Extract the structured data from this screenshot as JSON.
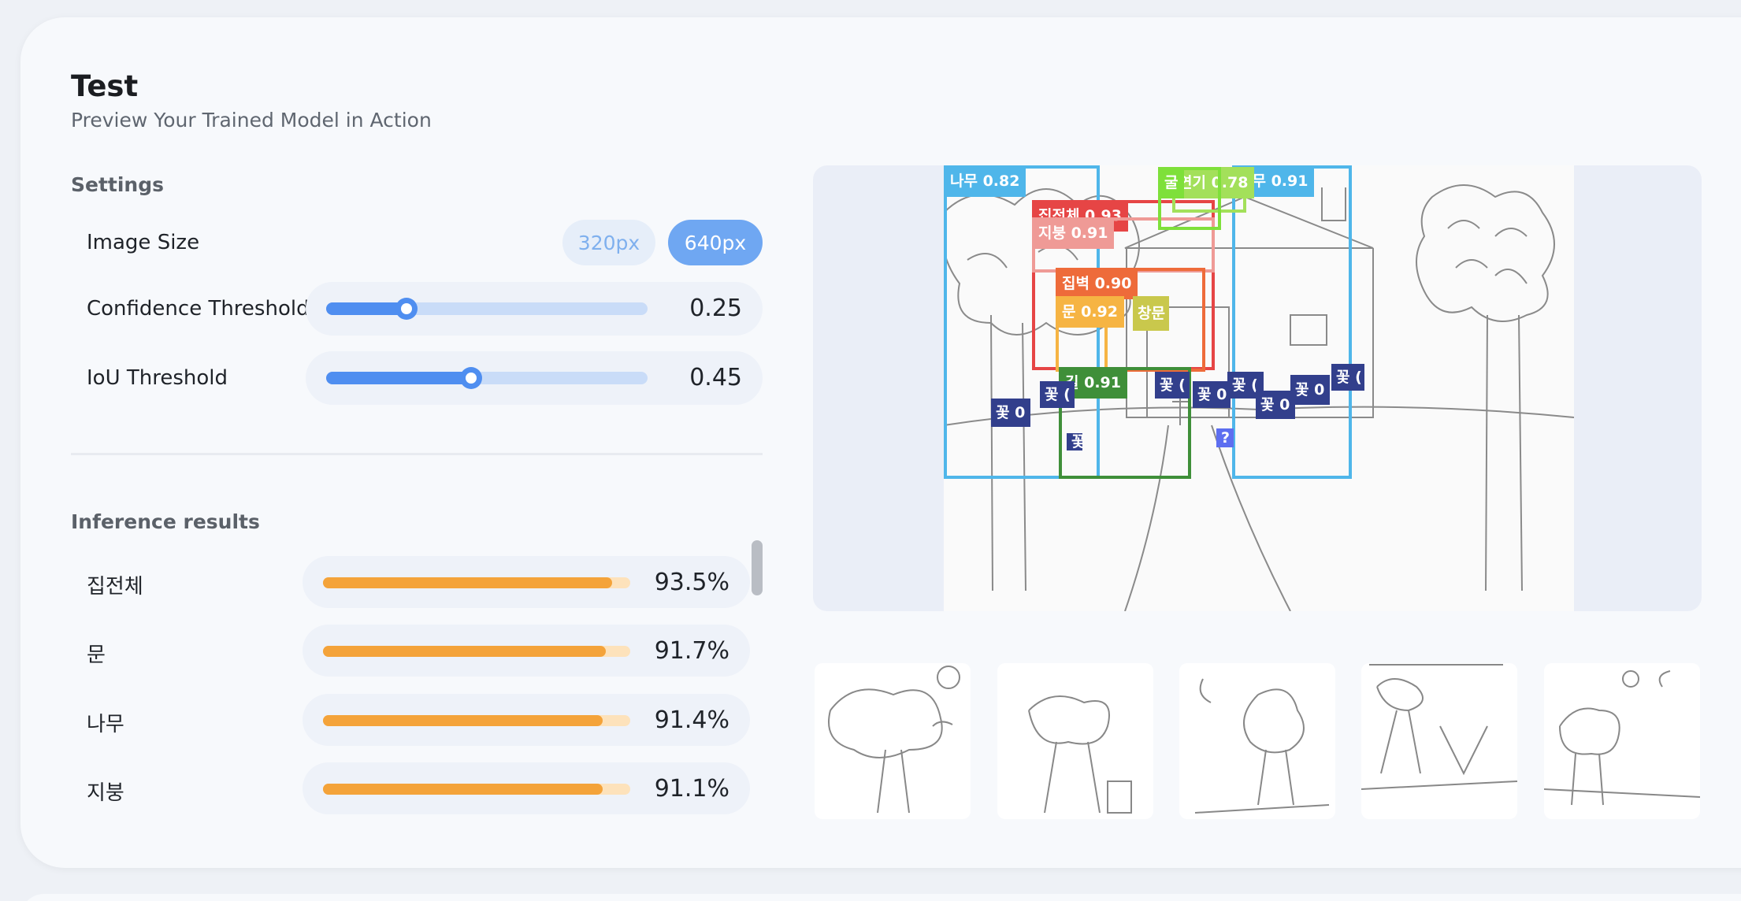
{
  "header": {
    "title": "Test",
    "subtitle": "Preview Your Trained Model in Action"
  },
  "settings": {
    "heading": "Settings",
    "image_size": {
      "label": "Image Size",
      "options": [
        "320px",
        "640px"
      ],
      "selected": "640px"
    },
    "confidence": {
      "label": "Confidence Threshold",
      "value": "0.25",
      "level": 0.25
    },
    "iou": {
      "label": "IoU Threshold",
      "value": "0.45",
      "level": 0.45
    }
  },
  "results": {
    "heading": "Inference results",
    "items": [
      {
        "label": "집전체",
        "value": "93.5%",
        "level": 0.935
      },
      {
        "label": "문",
        "value": "91.7%",
        "level": 0.917
      },
      {
        "label": "나무",
        "value": "91.4%",
        "level": 0.914
      },
      {
        "label": "지붕",
        "value": "91.1%",
        "level": 0.911
      }
    ]
  },
  "detections": [
    {
      "label": "나무 0.82",
      "color": "#4fb6ea"
    },
    {
      "label": "나무 0.91",
      "color": "#4fb6ea"
    },
    {
      "label": "집전체 0.93",
      "color": "#e64545"
    },
    {
      "label": "지붕 0.91",
      "color": "#ef9a96"
    },
    {
      "label": "집벽 0.90",
      "color": "#ee6b3a"
    },
    {
      "label": "문 0.92",
      "color": "#f6b443"
    },
    {
      "label": "창문 0",
      "color": "#c9c84c"
    },
    {
      "label": "연기 0.78",
      "color": "#a3e05a"
    },
    {
      "label": "굴",
      "color": "#7ee03a"
    },
    {
      "label": "길 0.91",
      "color": "#3f8f39"
    },
    {
      "label": "꽃 0",
      "color": "#323f8c"
    },
    {
      "label": "꽃 (",
      "color": "#323f8c"
    },
    {
      "label": "꽃 (",
      "color": "#323f8c"
    },
    {
      "label": "꽃 0",
      "color": "#323f8c"
    },
    {
      "label": "꽃 (",
      "color": "#323f8c"
    },
    {
      "label": "꽃 0",
      "color": "#323f8c"
    },
    {
      "label": "꽃 0",
      "color": "#323f8c"
    },
    {
      "label": "꽃 (",
      "color": "#323f8c"
    },
    {
      "label": "꽃",
      "color": "#323f8c"
    },
    {
      "label": "?",
      "color": "#5d6ef0"
    }
  ],
  "thumbnails": [
    {
      "name": "tree-drawing-1"
    },
    {
      "name": "tree-drawing-2"
    },
    {
      "name": "tree-drawing-3"
    },
    {
      "name": "tree-drawing-4"
    },
    {
      "name": "tree-drawing-5"
    }
  ]
}
